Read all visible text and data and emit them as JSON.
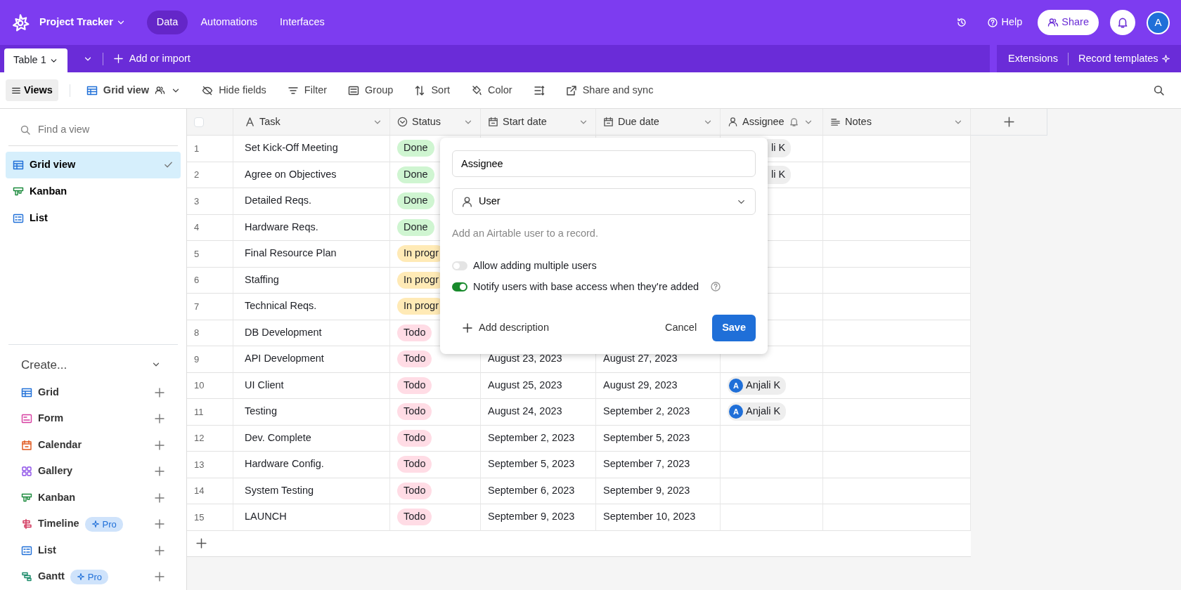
{
  "app": {
    "title": "Project Tracker",
    "nav": [
      {
        "label": "Data",
        "selected": true
      },
      {
        "label": "Automations",
        "selected": false
      },
      {
        "label": "Interfaces",
        "selected": false
      }
    ],
    "help": "Help",
    "share": "Share",
    "avatar": "A"
  },
  "tables": {
    "tabs": [
      {
        "label": "Table 1",
        "selected": true
      }
    ],
    "add": "Add or import",
    "extensions": "Extensions",
    "record_templates": "Record templates"
  },
  "toolbar": {
    "views": "Views",
    "view_name": "Grid view",
    "items": [
      {
        "kind": "hide",
        "label": "Hide fields"
      },
      {
        "kind": "filter",
        "label": "Filter"
      },
      {
        "kind": "group",
        "label": "Group"
      },
      {
        "kind": "sort",
        "label": "Sort"
      },
      {
        "kind": "color",
        "label": "Color"
      },
      {
        "kind": "rowheight"
      },
      {
        "kind": "share",
        "label": "Share and sync"
      }
    ]
  },
  "sidebar": {
    "search_placeholder": "Find a view",
    "views": [
      {
        "kind": "grid",
        "label": "Grid view",
        "selected": true
      },
      {
        "kind": "kanban",
        "label": "Kanban",
        "selected": false
      },
      {
        "kind": "list",
        "label": "List",
        "selected": false
      }
    ],
    "create_title": "Create...",
    "create": [
      {
        "kind": "grid",
        "label": "Grid"
      },
      {
        "kind": "form",
        "label": "Form"
      },
      {
        "kind": "calendar",
        "label": "Calendar"
      },
      {
        "kind": "gallery",
        "label": "Gallery"
      },
      {
        "kind": "kanban",
        "label": "Kanban"
      },
      {
        "kind": "timeline",
        "label": "Timeline",
        "badge": "Pro"
      },
      {
        "kind": "list",
        "label": "List"
      },
      {
        "kind": "gantt",
        "label": "Gantt",
        "badge": "Pro"
      }
    ]
  },
  "table": {
    "select_all": {
      "checked": false
    },
    "columns": [
      {
        "kind": "text",
        "label": "Task"
      },
      {
        "kind": "status",
        "label": "Status"
      },
      {
        "kind": "date",
        "label": "Start date"
      },
      {
        "kind": "date",
        "label": "Due date"
      },
      {
        "kind": "user",
        "label": "Assignee",
        "notify": true
      },
      {
        "kind": "notes",
        "label": "Notes"
      }
    ],
    "rows": [
      {
        "number": "1",
        "task": "Set Kick-Off Meeting",
        "status": {
          "text": "Done",
          "color": "#cff5d1"
        },
        "assignee": {
          "name": "li K"
        }
      },
      {
        "number": "2",
        "task": "Agree on Objectives",
        "status": {
          "text": "Done",
          "color": "#cff5d1"
        },
        "assignee": {
          "name": "li K"
        }
      },
      {
        "number": "3",
        "task": "Detailed Reqs.",
        "status": {
          "text": "Done",
          "color": "#cff5d1"
        }
      },
      {
        "number": "4",
        "task": "Hardware Reqs.",
        "status": {
          "text": "Done",
          "color": "#cff5d1"
        }
      },
      {
        "number": "5",
        "task": "Final Resource Plan",
        "status": {
          "text": "In progr",
          "color": "#ffeab6"
        }
      },
      {
        "number": "6",
        "task": "Staffing",
        "status": {
          "text": "In progr",
          "color": "#ffeab6"
        }
      },
      {
        "number": "7",
        "task": "Technical Reqs.",
        "status": {
          "text": "In progr",
          "color": "#ffeab6"
        }
      },
      {
        "number": "8",
        "task": "DB Development",
        "status": {
          "text": "Todo",
          "color": "#ffdce5"
        }
      },
      {
        "number": "9",
        "task": "API Development",
        "status": {
          "text": "Todo",
          "color": "#ffdce5"
        },
        "start": "August 23, 2023",
        "due": "August 27, 2023"
      },
      {
        "number": "10",
        "task": "UI Client",
        "status": {
          "text": "Todo",
          "color": "#ffdce5"
        },
        "start": "August 25, 2023",
        "due": "August 29, 2023",
        "assignee": {
          "avatar": "A",
          "name": "Anjali K"
        }
      },
      {
        "number": "11",
        "task": "Testing",
        "status": {
          "text": "Todo",
          "color": "#ffdce5"
        },
        "start": "August 24, 2023",
        "due": "September 2, 2023",
        "assignee": {
          "avatar": "A",
          "name": "Anjali K"
        }
      },
      {
        "number": "12",
        "task": "Dev. Complete",
        "status": {
          "text": "Todo",
          "color": "#ffdce5"
        },
        "start": "September 2, 2023",
        "due": "September 5, 2023"
      },
      {
        "number": "13",
        "task": "Hardware Config.",
        "status": {
          "text": "Todo",
          "color": "#ffdce5"
        },
        "start": "September 5, 2023",
        "due": "September 7, 2023"
      },
      {
        "number": "14",
        "task": "System Testing",
        "status": {
          "text": "Todo",
          "color": "#ffdce5"
        },
        "start": "September 6, 2023",
        "due": "September 9, 2023"
      },
      {
        "number": "15",
        "task": "LAUNCH",
        "status": {
          "text": "Todo",
          "color": "#ffdce5"
        },
        "start": "September 9, 2023",
        "due": "September 10, 2023"
      }
    ]
  },
  "field_editor": {
    "name": "Assignee",
    "type": "User",
    "description": "Add an Airtable user to a record.",
    "toggles": [
      {
        "label": "Allow adding multiple users",
        "on": false
      },
      {
        "label": "Notify users with base access when they're added",
        "on": true,
        "help": true
      }
    ],
    "add_description": "Add description",
    "cancel": "Cancel",
    "save": "Save"
  }
}
